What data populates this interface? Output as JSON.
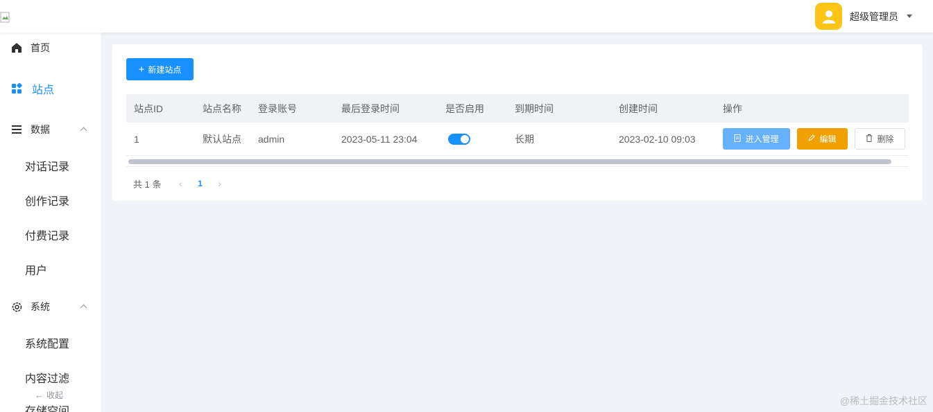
{
  "header": {
    "username": "超级管理员"
  },
  "sidebar": {
    "items": [
      {
        "label": "首页",
        "icon": "home-icon"
      },
      {
        "label": "站点",
        "icon": "grid-icon",
        "active": true
      },
      {
        "label": "数据",
        "icon": "menu-icon"
      },
      {
        "label": "系统",
        "icon": "gear-icon"
      }
    ],
    "data_sub": [
      "对话记录",
      "创作记录",
      "付费记录",
      "用户"
    ],
    "system_sub": [
      "系统配置",
      "内容过滤",
      "存储空间"
    ],
    "collapse_label": "收起"
  },
  "toolbar": {
    "new_label": "新建站点"
  },
  "table": {
    "columns": [
      "站点ID",
      "站点名称",
      "登录账号",
      "最后登录时间",
      "是否启用",
      "到期时间",
      "创建时间",
      "操作"
    ],
    "rows": [
      {
        "id": "1",
        "name": "默认站点",
        "account": "admin",
        "last_login": "2023-05-11 23:04",
        "enabled": true,
        "expire": "长期",
        "created": "2023-02-10 09:03",
        "ops": {
          "enter": "进入管理",
          "edit": "编辑",
          "delete": "删除"
        }
      }
    ]
  },
  "pagination": {
    "total_text": "共 1 条",
    "current_page": "1"
  },
  "watermark": "@稀土掘金技术社区",
  "colors": {
    "primary": "#1890ff",
    "warning": "#f0a000",
    "avatar": "#fec517"
  }
}
